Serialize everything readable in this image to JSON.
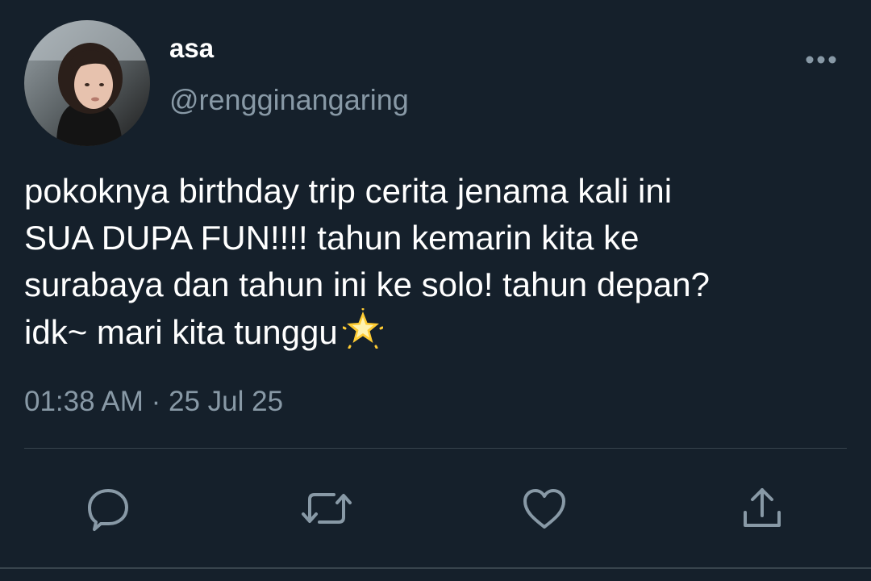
{
  "tweet": {
    "author": {
      "display_name": "asa",
      "handle": "@rengginangaring"
    },
    "text_lines": [
      "pokoknya birthday trip cerita jenama kali ini",
      "SUA DUPA FUN!!!! tahun kemarin kita ke",
      "surabaya dan tahun ini ke solo! tahun depan?",
      "idk~ mari kita tunggu"
    ],
    "emoji": "glowing-star",
    "timestamp": "01:38 AM · 25 Jul 25"
  },
  "actions": [
    {
      "name": "reply",
      "icon": "speech-bubble-icon"
    },
    {
      "name": "retweet",
      "icon": "retweet-icon"
    },
    {
      "name": "like",
      "icon": "heart-icon"
    },
    {
      "name": "share",
      "icon": "share-icon"
    }
  ],
  "colors": {
    "background": "#15202b",
    "primary_text": "#ffffff",
    "secondary_text": "#8899a6",
    "divider": "#38444d",
    "icon": "#8899a6"
  }
}
